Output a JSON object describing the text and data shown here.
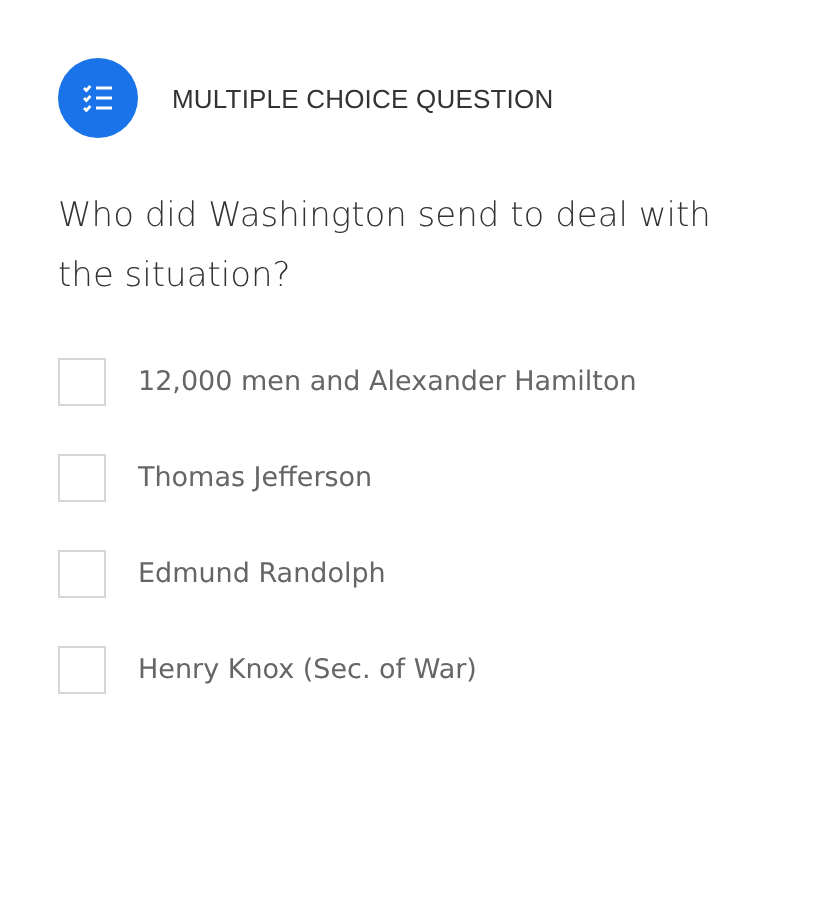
{
  "header": {
    "label": "MULTIPLE CHOICE QUESTION"
  },
  "question": "Who did Washington send to deal with the situation?",
  "options": [
    {
      "label": "12,000 men and Alexander Hamilton",
      "checked": false
    },
    {
      "label": "Thomas Jefferson",
      "checked": false
    },
    {
      "label": "Edmund Randolph",
      "checked": false
    },
    {
      "label": "Henry Knox (Sec. of War)",
      "checked": false
    }
  ]
}
